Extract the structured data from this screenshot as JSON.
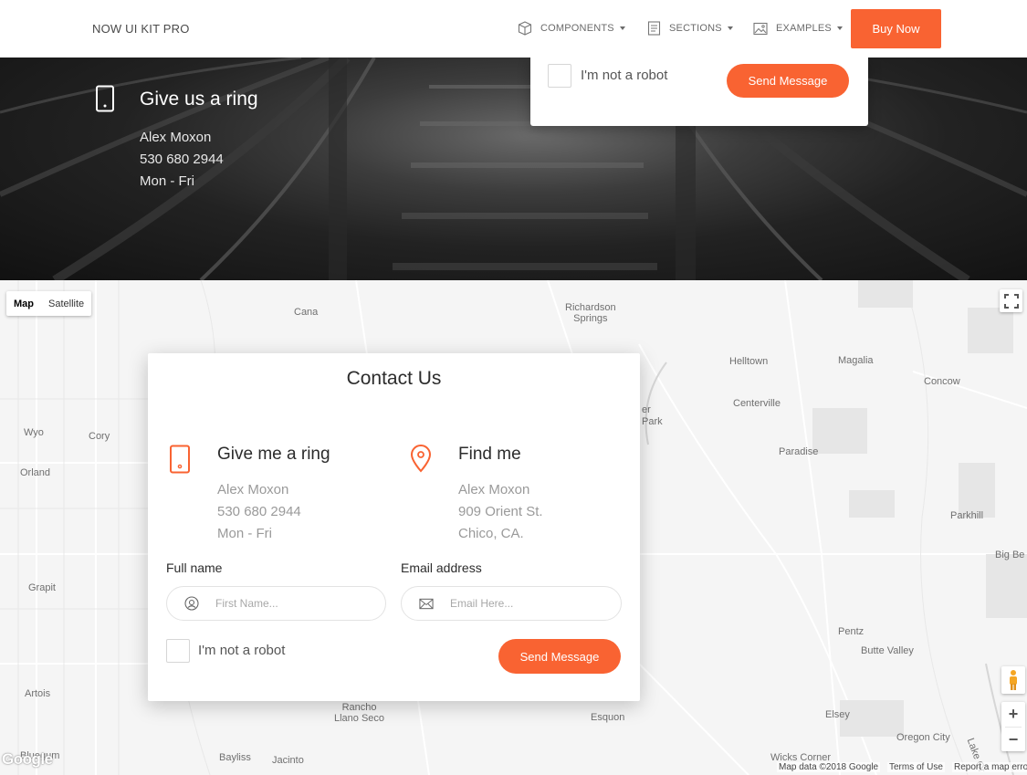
{
  "nav": {
    "brand": "NOW UI KIT PRO",
    "items": [
      {
        "label": "COMPONENTS",
        "icon": "box-icon"
      },
      {
        "label": "SECTIONS",
        "icon": "document-icon"
      },
      {
        "label": "EXAMPLES",
        "icon": "image-icon"
      }
    ],
    "buy_label": "Buy Now"
  },
  "hero": {
    "title": "Give us a ring",
    "lines": [
      "Alex Moxon",
      "530 680 2944",
      "Mon - Fri"
    ],
    "icon": "mobile-phone-icon"
  },
  "top_form": {
    "robot_label": "I'm not a robot",
    "send_label": "Send Message"
  },
  "map": {
    "type_map": "Map",
    "type_satellite": "Satellite",
    "places": {
      "cana": "Cana",
      "richardson": "Richardson\nSprings",
      "helltown": "Helltown",
      "magalia": "Magalia",
      "concow": "Concow",
      "centerville": "Centerville",
      "park": "Park",
      "er": "er",
      "paradise": "Paradise",
      "wyo": "Wyo",
      "cory": "Cory",
      "orland": "Orland",
      "parkhill": "Parkhill",
      "bigbe": "Big Be",
      "grapit": "Grapit",
      "pentz": "Pentz",
      "butte_valley": "Butte Valley",
      "artois": "Artois",
      "rancho": "Rancho\nLlano Seco",
      "esquon": "Esquon",
      "elsey": "Elsey",
      "oregon_city": "Oregon City",
      "bluegum": "Bluegum",
      "bayliss": "Bayliss",
      "jacinto": "Jacinto",
      "wicks": "Wicks Corner",
      "lake": "Lake Or"
    },
    "google": "Google",
    "map_data": "Map data ©2018 Google",
    "terms": "Terms of Use",
    "report": "Report a map erro"
  },
  "contact": {
    "title": "Contact Us",
    "ring": {
      "title": "Give me a ring",
      "lines": [
        "Alex Moxon",
        "530 680 2944",
        "Mon - Fri"
      ]
    },
    "find": {
      "title": "Find me",
      "lines": [
        "Alex Moxon",
        "909 Orient St.",
        "Chico, CA."
      ]
    },
    "full_name_label": "Full name",
    "full_name_placeholder": "First Name...",
    "email_label": "Email address",
    "email_placeholder": "Email Here...",
    "robot_label": "I'm not a robot",
    "send_label": "Send Message"
  },
  "colors": {
    "accent": "#f96332",
    "map_bg": "#f5f5f5"
  }
}
